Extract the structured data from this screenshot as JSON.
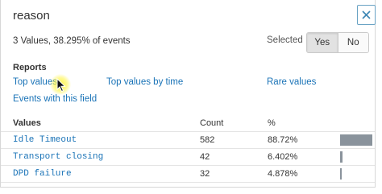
{
  "title": "reason",
  "summary": "3 Values, 38.295% of events",
  "selected": {
    "label": "Selected",
    "yes": "Yes",
    "no": "No",
    "active": "Yes"
  },
  "reports": {
    "heading": "Reports",
    "links": [
      "Top values",
      "Top values by time",
      "Rare values",
      "Events with this field"
    ]
  },
  "table": {
    "headers": {
      "values": "Values",
      "count": "Count",
      "percent": "%"
    },
    "rows": [
      {
        "value": "Idle Timeout",
        "count": "582",
        "percent": "88.72%",
        "fraction": 0.8872
      },
      {
        "value": "Transport closing",
        "count": "42",
        "percent": "6.402%",
        "fraction": 0.06402
      },
      {
        "value": "DPD failure",
        "count": "32",
        "percent": "4.878%",
        "fraction": 0.04878
      }
    ]
  },
  "colors": {
    "link": "#1a73b7",
    "bar": "#8a939c",
    "close_border": "#6aa3c4"
  },
  "icons": {
    "close": "close-icon",
    "cursor": "mouse-pointer-icon"
  }
}
